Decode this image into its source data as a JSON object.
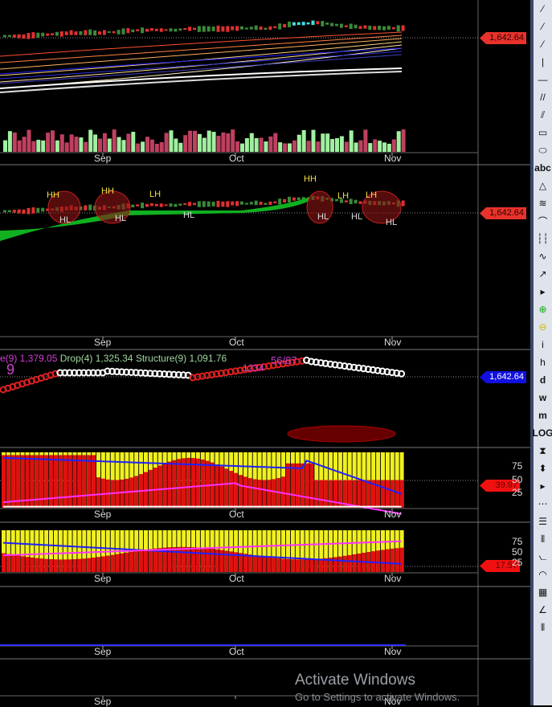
{
  "x_axis": {
    "labels": [
      "Sep",
      "Oct",
      "Nov"
    ]
  },
  "price": {
    "last": "1,642.64",
    "tag_color_1": "#e8322b",
    "tag_color_3": "#1010e0"
  },
  "indicator_text": {
    "part1": "e(9) 1,379.05",
    "part2": "Drop(4) 1,325.34",
    "part3": "Structure(9) 1,091.76",
    "count_big": "9",
    "count_seq": "1234",
    "count_seq2": "56/87"
  },
  "structure_labels": [
    {
      "text": "HH"
    },
    {
      "text": "HL"
    },
    {
      "text": "HH"
    },
    {
      "text": "HL"
    },
    {
      "text": "LH"
    },
    {
      "text": "HL"
    },
    {
      "text": "HH"
    },
    {
      "text": "HL"
    },
    {
      "text": "LH"
    },
    {
      "text": "HL"
    },
    {
      "text": "LH"
    },
    {
      "text": "HL"
    }
  ],
  "oscillator1": {
    "value": "39.97",
    "levels": [
      "75",
      "50",
      "25"
    ]
  },
  "oscillator2": {
    "value": "17.57",
    "levels": [
      "75",
      "50",
      "25"
    ]
  },
  "toolbar": {
    "items": [
      "trendline",
      "ray",
      "extended-line",
      "vertical-line",
      "horizontal-line",
      "parallel-channel",
      "pitchfork",
      "rectangle",
      "ellipse",
      "abc",
      "triangle",
      "fibonacci",
      "arc",
      "time-zones",
      "polyline",
      "arrow",
      "expand",
      "zoom-in",
      "zoom-out",
      "info",
      "h",
      "d",
      "w",
      "m",
      "LOG",
      "hourglass",
      "up-down",
      "expand2",
      "dots",
      "lines",
      "bars",
      "fan",
      "rainbow",
      "grid",
      "angle",
      "cycles"
    ],
    "abc": "abc",
    "d": "d",
    "w": "w",
    "m": "m",
    "log": "LOG",
    "i": "i",
    "h": "h"
  },
  "watermark": {
    "title": "Activate Windows",
    "sub": "Go to Settings to activate Windows."
  }
}
